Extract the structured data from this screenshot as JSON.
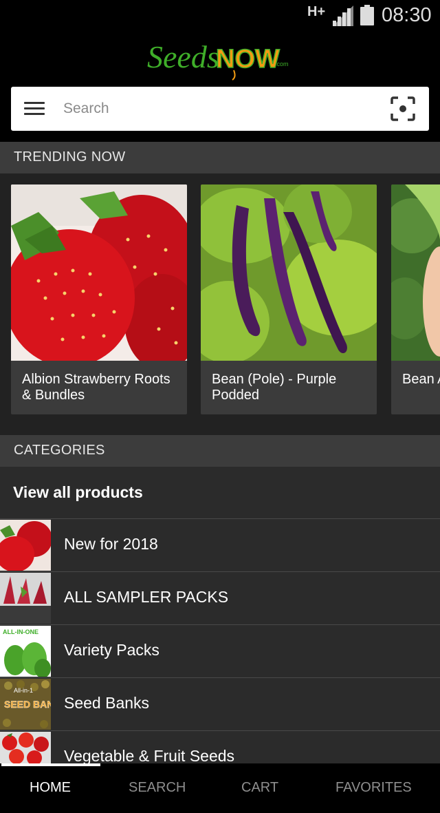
{
  "status_bar": {
    "network": "H+",
    "time": "08:30"
  },
  "logo": {
    "part1": "Seeds",
    "part2": "NOW",
    "suffix": ".com"
  },
  "search": {
    "placeholder": "Search",
    "value": ""
  },
  "trending": {
    "header": "TRENDING NOW",
    "items": [
      {
        "title": "Albion Strawberry Roots & Bundles",
        "image": "strawberries"
      },
      {
        "title": "Bean (Pole) - Purple Podded",
        "image": "purple-beans"
      },
      {
        "title": "Bean AGUA",
        "image": "green-beans"
      }
    ]
  },
  "categories": {
    "header": "CATEGORIES",
    "view_all": "View all products",
    "items": [
      {
        "label": "New for 2018",
        "thumb": "strawberries"
      },
      {
        "label": "ALL SAMPLER PACKS",
        "thumb": "red-flowers"
      },
      {
        "label": "Variety Packs",
        "thumb": "cucumbers",
        "thumb_text": "ALL-IN-ONE"
      },
      {
        "label": "Seed Banks",
        "thumb": "seed-bank",
        "thumb_text": "SEED BANKS",
        "thumb_small": "All-in-1"
      },
      {
        "label": "Vegetable & Fruit Seeds",
        "thumb": "tomatoes"
      }
    ]
  },
  "bottom_nav": {
    "items": [
      "HOME",
      "SEARCH",
      "CART",
      "FAVORITES"
    ],
    "active": "HOME"
  },
  "colors": {
    "background": "#000000",
    "section_header": "#3c3c3c",
    "list_background": "#2b2b2b",
    "card_background": "#3b3b3b",
    "logo_green": "#3fae29",
    "logo_orange": "#f39c12"
  }
}
